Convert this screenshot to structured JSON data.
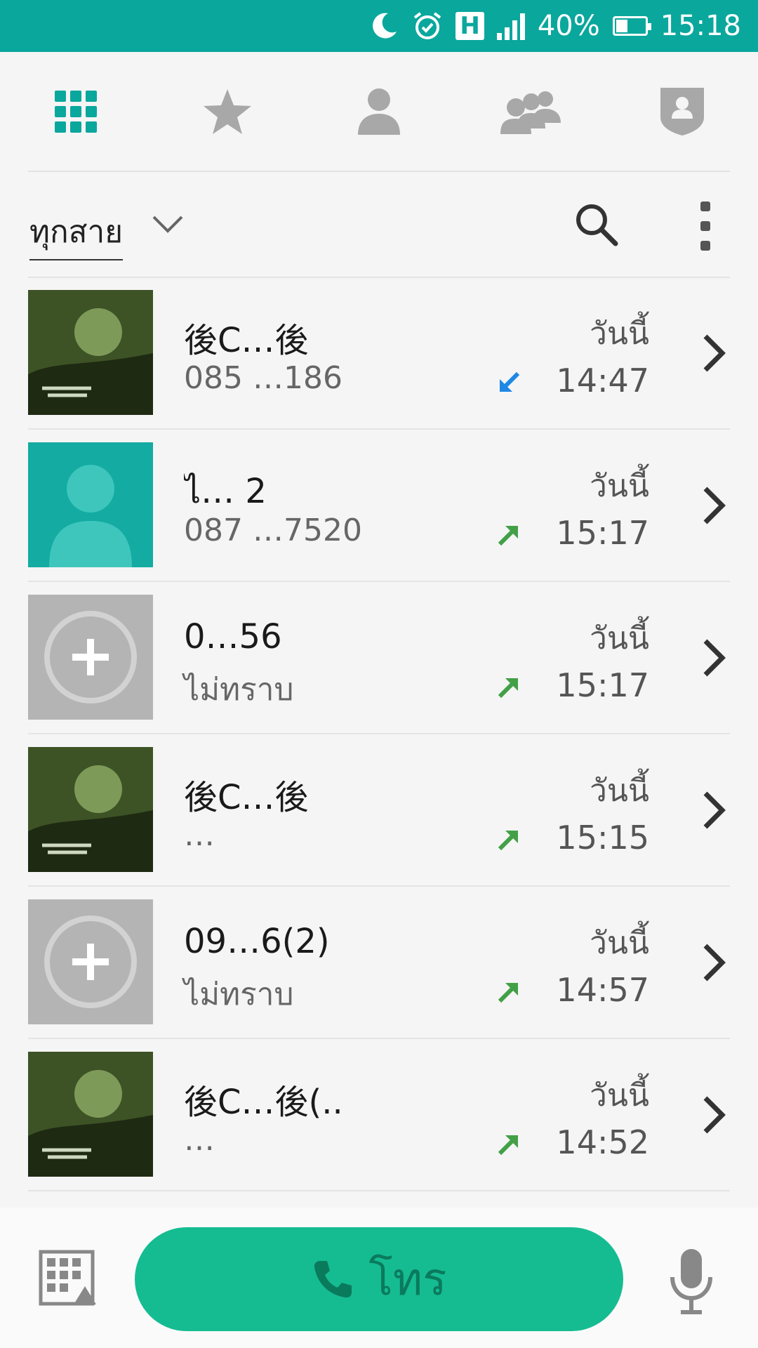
{
  "status_bar": {
    "network_type": "H",
    "battery_percent": "40%",
    "battery_level": 0.4,
    "time": "15:18",
    "icons": [
      "moon-icon",
      "alarm-icon",
      "network-type-icon",
      "signal-icon",
      "battery-icon"
    ]
  },
  "tabs": [
    {
      "name": "dialpad",
      "icon": "dialpad-grid-icon",
      "selected": true
    },
    {
      "name": "favorites",
      "icon": "star-icon",
      "selected": false
    },
    {
      "name": "contacts",
      "icon": "person-icon",
      "selected": false
    },
    {
      "name": "groups",
      "icon": "group-icon",
      "selected": false
    },
    {
      "name": "profile",
      "icon": "shield-person-icon",
      "selected": false
    }
  ],
  "filter": {
    "label": "ทุกสาย"
  },
  "calls": [
    {
      "name": "後C…後",
      "number": "085 …186",
      "day": "วันนี้",
      "time": "14:47",
      "direction": "incoming",
      "avatar": "photo"
    },
    {
      "name": "ไ… 2",
      "number": "087 …7520",
      "day": "วันนี้",
      "time": "15:17",
      "direction": "outgoing",
      "avatar": "default"
    },
    {
      "name": "0…56",
      "number": "ไม่ทราบ",
      "day": "วันนี้",
      "time": "15:17",
      "direction": "outgoing",
      "avatar": "add"
    },
    {
      "name": "後C…後",
      "number": "…",
      "day": "วันนี้",
      "time": "15:15",
      "direction": "outgoing",
      "avatar": "photo"
    },
    {
      "name": "09…6(2)",
      "number": "ไม่ทราบ",
      "day": "วันนี้",
      "time": "14:57",
      "direction": "outgoing",
      "avatar": "add"
    },
    {
      "name": "後C…後(..",
      "number": "…",
      "day": "วันนี้",
      "time": "14:52",
      "direction": "outgoing",
      "avatar": "photo"
    }
  ],
  "bottom": {
    "call_label": "โทร",
    "colors": {
      "call_button": "#15bc91",
      "accent": "#0aa79d"
    }
  }
}
